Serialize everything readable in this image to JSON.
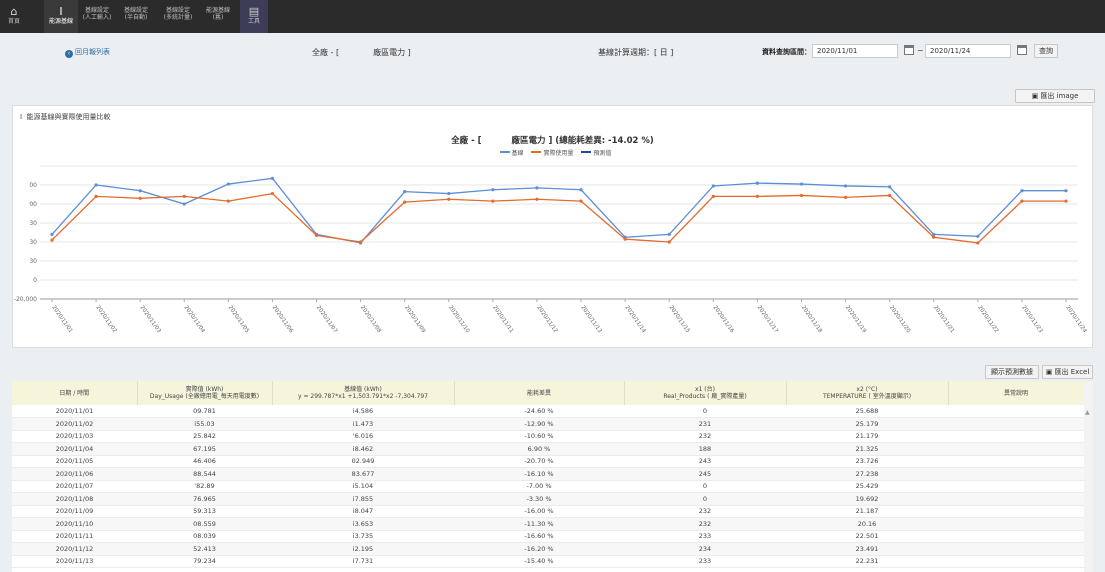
{
  "nav": {
    "items": [
      {
        "icon": "home-icon",
        "glyph": "⌂",
        "line1": "首頁",
        "line2": ""
      },
      {
        "icon": "baseline-icon",
        "glyph": "I",
        "line1": "能源基線",
        "line2": ""
      },
      {
        "icon": "",
        "glyph": "",
        "line1": "基線設定",
        "line2": "(人工輸入)"
      },
      {
        "icon": "",
        "glyph": "",
        "line1": "基線設定",
        "line2": "(半自動)"
      },
      {
        "icon": "",
        "glyph": "",
        "line1": "基線設定",
        "line2": "(多統計量)"
      },
      {
        "icon": "",
        "glyph": "",
        "line1": "能源基線",
        "line2": "(舊)"
      },
      {
        "icon": "toolbox-icon",
        "glyph": "▤",
        "line1": "工具",
        "line2": ""
      }
    ]
  },
  "filter": {
    "back_label": "回月報列表",
    "scope_prefix": "全廠 - [",
    "scope_suffix": "廠區電力 ]",
    "period_text": "基線計算週期：[ 日 ]",
    "range_label": "資料查詢區間：",
    "date_from": "2020/11/01",
    "date_to": "2020/11/24",
    "tilde": "~",
    "query_label": "查詢"
  },
  "export_image_label": "匯出 image",
  "chart_panel": {
    "title": "能源基線與實際使用量比較",
    "chart_title_prefix": "全廠 - [",
    "chart_title_suffix": "廠區電力 ]  (總能耗差異: -14.02 %)"
  },
  "chart_data": {
    "type": "line",
    "x": [
      "2020/11/01",
      "2020/11/02",
      "2020/11/03",
      "2020/11/04",
      "2020/11/05",
      "2020/11/06",
      "2020/11/07",
      "2020/11/08",
      "2020/11/09",
      "2020/11/10",
      "2020/11/11",
      "2020/11/12",
      "2020/11/13",
      "2020/11/14",
      "2020/11/15",
      "2020/11/16",
      "2020/11/17",
      "2020/11/18",
      "2020/11/19",
      "2020/11/20",
      "2020/11/21",
      "2020/11/22",
      "2020/11/23",
      "2020/11/24"
    ],
    "y_ticks": [
      "00",
      "00",
      "30",
      "30",
      "30",
      "0",
      "-20,000"
    ],
    "y_tick_values": [
      120000,
      100000,
      80000,
      60000,
      40000,
      20000,
      0,
      -20000
    ],
    "ylim": [
      -20000,
      120000
    ],
    "series": [
      {
        "name": "基線",
        "color": "#5b8fd6",
        "values": [
          48000,
          100000,
          94000,
          80000,
          101000,
          107000,
          48000,
          39000,
          93000,
          91000,
          95000,
          97000,
          95000,
          45000,
          48000,
          99000,
          102000,
          101000,
          99000,
          98000,
          48000,
          46000,
          94000,
          94000
        ]
      },
      {
        "name": "實際使用量",
        "color": "#e36b2c",
        "values": [
          42000,
          88000,
          86000,
          88000,
          83000,
          91000,
          47000,
          40000,
          82000,
          85000,
          83000,
          85000,
          83000,
          43000,
          40000,
          88000,
          88000,
          89000,
          87000,
          89000,
          45000,
          39000,
          83000,
          83000
        ]
      },
      {
        "name": "預測值",
        "color": "#1f4e9c",
        "values": []
      }
    ]
  },
  "table_tools": {
    "show_predicted": "顯示預測數據",
    "export_excel": "匯出 Excel"
  },
  "table": {
    "headers": [
      {
        "l1": "",
        "l2": "日期 / 時間"
      },
      {
        "l1": "實際值 (kWh)",
        "l2": "Day_Usage (全廠總用電_每天用電度數)"
      },
      {
        "l1": "基線值 (kWh)",
        "l2": "y = 299.787*x1 +1,503.791*x2 -7,304.797"
      },
      {
        "l1": "",
        "l2": "能耗差異"
      },
      {
        "l1": "x1 (台)",
        "l2": "Real_Products (     廠_實際產量)"
      },
      {
        "l1": "x2 (°C)",
        "l2": "TEMPERATURE (     室外溫度顯示)"
      },
      {
        "l1": "",
        "l2": "異常說明"
      }
    ],
    "rows": [
      [
        "2020/11/01",
        "09.781",
        "i4.586",
        "-24.60 %",
        "0",
        "25.688",
        ""
      ],
      [
        "2020/11/02",
        "i55.03",
        "i1.473",
        "-12.90 %",
        "231",
        "25.179",
        ""
      ],
      [
        "2020/11/03",
        "25.842",
        "'6.016",
        "-10.60 %",
        "232",
        "21.179",
        ""
      ],
      [
        "2020/11/04",
        "67.195",
        "i8.462",
        "6.90 %",
        "188",
        "21.325",
        ""
      ],
      [
        "2020/11/05",
        "46.406",
        "02.949",
        "-20.70 %",
        "243",
        "23.726",
        ""
      ],
      [
        "2020/11/06",
        "88.544",
        "83.677",
        "-16.10 %",
        "245",
        "27.238",
        ""
      ],
      [
        "2020/11/07",
        "'82.89",
        "i5.104",
        "-7.00 %",
        "0",
        "25.429",
        ""
      ],
      [
        "2020/11/08",
        "76.965",
        "i7.855",
        "-3.30 %",
        "0",
        "19.692",
        ""
      ],
      [
        "2020/11/09",
        "59.313",
        "i8.047",
        "-16.00 %",
        "232",
        "21.187",
        ""
      ],
      [
        "2020/11/10",
        "08.559",
        "i3.653",
        "-11.30 %",
        "232",
        "20.16",
        ""
      ],
      [
        "2020/11/11",
        "08.039",
        "i3.735",
        "-16.60 %",
        "233",
        "22.501",
        ""
      ],
      [
        "2020/11/12",
        "52.413",
        "i2.195",
        "-16.20 %",
        "234",
        "23.491",
        ""
      ],
      [
        "2020/11/13",
        "79.234",
        "i7.731",
        "-15.40 %",
        "233",
        "22.231",
        ""
      ]
    ]
  },
  "colors": {
    "nav_bg": "#2b2b2b",
    "page_bg": "#eceff2",
    "baseline": "#5b8fd6",
    "actual": "#e36b2c",
    "predicted": "#1f4e9c",
    "table_header_bg": "#f5f5dc"
  }
}
